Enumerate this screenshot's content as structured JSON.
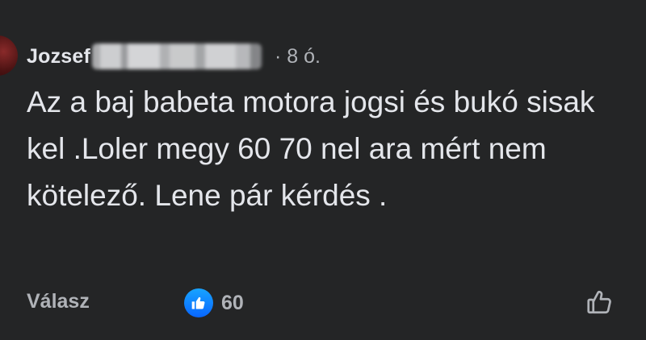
{
  "comment": {
    "author": "Jozsef",
    "meta": "· 8 ó.",
    "text": "Az a baj babeta motora jogsi és bukó sisak kel .Loler megy 60 70 nel ara mért nem kötelező. Lene pár kérdés ."
  },
  "actions": {
    "reply_label": "Válasz",
    "like_count": "60"
  },
  "icons": {
    "reaction": "like-thumb-icon",
    "like_button": "thumbs-up-outline-icon"
  },
  "colors": {
    "background": "#242526",
    "text_primary": "#e4e6eb",
    "text_secondary": "#b0b3b8",
    "like_blue": "#0866ff"
  }
}
